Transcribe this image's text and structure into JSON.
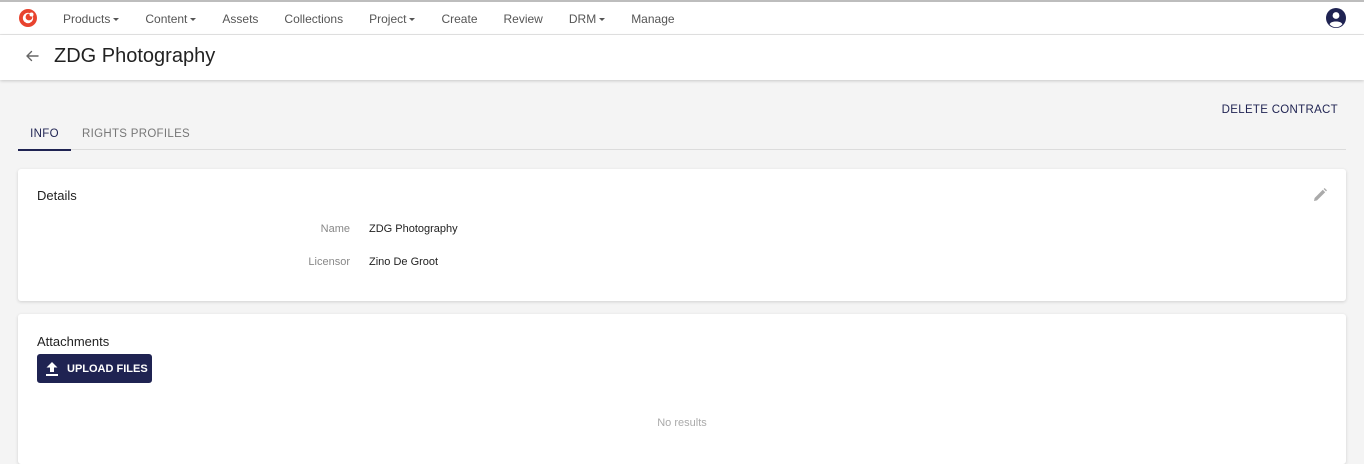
{
  "nav": {
    "items": [
      {
        "label": "Products",
        "dropdown": true
      },
      {
        "label": "Content",
        "dropdown": true
      },
      {
        "label": "Assets",
        "dropdown": false
      },
      {
        "label": "Collections",
        "dropdown": false
      },
      {
        "label": "Project",
        "dropdown": true
      },
      {
        "label": "Create",
        "dropdown": false
      },
      {
        "label": "Review",
        "dropdown": false
      },
      {
        "label": "DRM",
        "dropdown": true
      },
      {
        "label": "Manage",
        "dropdown": false
      }
    ],
    "logo_icon": "app-logo-icon",
    "avatar_icon": "user-avatar-icon"
  },
  "header": {
    "title": "ZDG Photography",
    "back_icon": "arrow-left-icon"
  },
  "actions": {
    "delete_label": "DELETE CONTRACT"
  },
  "tabs": [
    {
      "label": "INFO",
      "active": true
    },
    {
      "label": "RIGHTS PROFILES",
      "active": false
    }
  ],
  "details": {
    "title": "Details",
    "edit_icon": "pencil-icon",
    "fields": [
      {
        "label": "Name",
        "value": "ZDG Photography"
      },
      {
        "label": "Licensor",
        "value": "Zino De Groot"
      }
    ]
  },
  "attachments": {
    "title": "Attachments",
    "upload_label": "UPLOAD FILES",
    "upload_icon": "upload-icon",
    "empty_text": "No results"
  },
  "colors": {
    "accent": "#1f2352",
    "logo": "#e8432e",
    "background": "#f4f4f4"
  }
}
